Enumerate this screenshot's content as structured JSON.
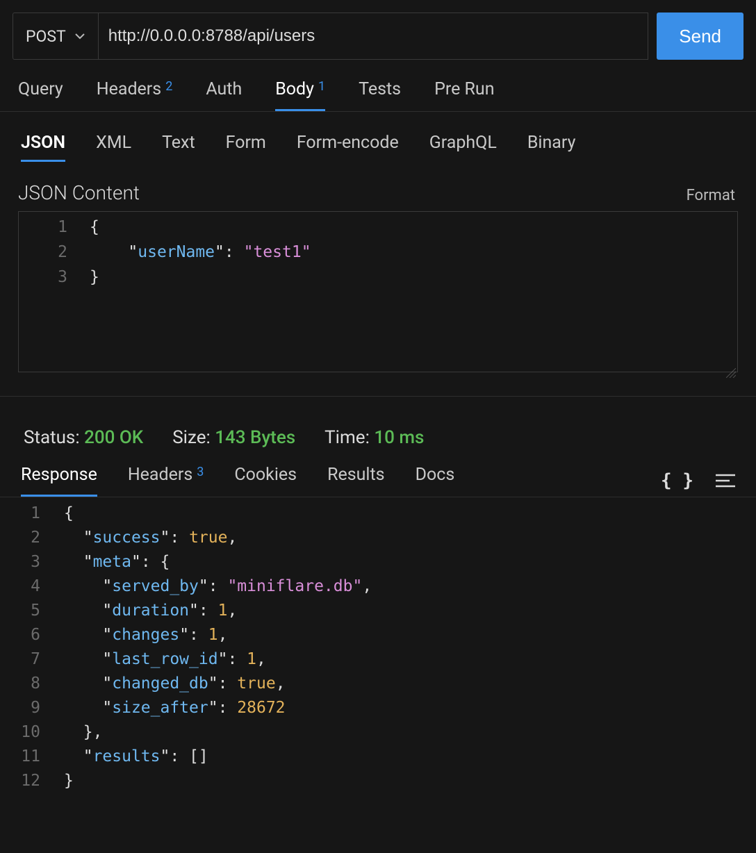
{
  "request": {
    "method": "POST",
    "url": "http://0.0.0.0:8788/api/users",
    "send_label": "Send"
  },
  "tabs": {
    "query": "Query",
    "headers": "Headers",
    "headers_badge": "2",
    "auth": "Auth",
    "body": "Body",
    "body_badge": "1",
    "tests": "Tests",
    "prerun": "Pre Run"
  },
  "body_subtabs": {
    "json": "JSON",
    "xml": "XML",
    "text": "Text",
    "form": "Form",
    "form_encode": "Form-encode",
    "graphql": "GraphQL",
    "binary": "Binary"
  },
  "body_editor": {
    "title": "JSON Content",
    "format_label": "Format",
    "lines": [
      [
        [
          "brace",
          "{"
        ]
      ],
      [
        [
          "indent",
          "    "
        ],
        [
          "quote-key",
          "\""
        ],
        [
          "key",
          "userName"
        ],
        [
          "quote-key",
          "\""
        ],
        [
          "colon",
          ": "
        ],
        [
          "quote-str",
          "\""
        ],
        [
          "str",
          "test1"
        ],
        [
          "quote-str",
          "\""
        ]
      ],
      [
        [
          "brace",
          "}"
        ]
      ]
    ]
  },
  "status": {
    "status_label": "Status: ",
    "status_value": "200 OK",
    "size_label": "Size: ",
    "size_value": "143 Bytes",
    "time_label": "Time: ",
    "time_value": "10 ms"
  },
  "resp_tabs": {
    "response": "Response",
    "headers": "Headers",
    "headers_badge": "3",
    "cookies": "Cookies",
    "results": "Results",
    "docs": "Docs"
  },
  "response_body": {
    "lines": [
      [
        [
          "brace",
          "{"
        ]
      ],
      [
        [
          "indent",
          "  "
        ],
        [
          "quote-key",
          "\""
        ],
        [
          "key",
          "success"
        ],
        [
          "quote-key",
          "\""
        ],
        [
          "colon",
          ": "
        ],
        [
          "kw",
          "true"
        ],
        [
          "punct",
          ","
        ]
      ],
      [
        [
          "indent",
          "  "
        ],
        [
          "quote-key",
          "\""
        ],
        [
          "key",
          "meta"
        ],
        [
          "quote-key",
          "\""
        ],
        [
          "colon",
          ": "
        ],
        [
          "brace",
          "{"
        ]
      ],
      [
        [
          "indent",
          "    "
        ],
        [
          "quote-key",
          "\""
        ],
        [
          "key",
          "served_by"
        ],
        [
          "quote-key",
          "\""
        ],
        [
          "colon",
          ": "
        ],
        [
          "quote-str",
          "\""
        ],
        [
          "str",
          "miniflare.db"
        ],
        [
          "quote-str",
          "\""
        ],
        [
          "punct",
          ","
        ]
      ],
      [
        [
          "indent",
          "    "
        ],
        [
          "quote-key",
          "\""
        ],
        [
          "key",
          "duration"
        ],
        [
          "quote-key",
          "\""
        ],
        [
          "colon",
          ": "
        ],
        [
          "num",
          "1"
        ],
        [
          "punct",
          ","
        ]
      ],
      [
        [
          "indent",
          "    "
        ],
        [
          "quote-key",
          "\""
        ],
        [
          "key",
          "changes"
        ],
        [
          "quote-key",
          "\""
        ],
        [
          "colon",
          ": "
        ],
        [
          "num",
          "1"
        ],
        [
          "punct",
          ","
        ]
      ],
      [
        [
          "indent",
          "    "
        ],
        [
          "quote-key",
          "\""
        ],
        [
          "key",
          "last_row_id"
        ],
        [
          "quote-key",
          "\""
        ],
        [
          "colon",
          ": "
        ],
        [
          "num",
          "1"
        ],
        [
          "punct",
          ","
        ]
      ],
      [
        [
          "indent",
          "    "
        ],
        [
          "quote-key",
          "\""
        ],
        [
          "key",
          "changed_db"
        ],
        [
          "quote-key",
          "\""
        ],
        [
          "colon",
          ": "
        ],
        [
          "kw",
          "true"
        ],
        [
          "punct",
          ","
        ]
      ],
      [
        [
          "indent",
          "    "
        ],
        [
          "quote-key",
          "\""
        ],
        [
          "key",
          "size_after"
        ],
        [
          "quote-key",
          "\""
        ],
        [
          "colon",
          ": "
        ],
        [
          "num",
          "28672"
        ]
      ],
      [
        [
          "indent",
          "  "
        ],
        [
          "brace",
          "}"
        ],
        [
          "punct",
          ","
        ]
      ],
      [
        [
          "indent",
          "  "
        ],
        [
          "quote-key",
          "\""
        ],
        [
          "key",
          "results"
        ],
        [
          "quote-key",
          "\""
        ],
        [
          "colon",
          ": "
        ],
        [
          "punct",
          "[]"
        ]
      ],
      [
        [
          "brace",
          "}"
        ]
      ]
    ]
  }
}
